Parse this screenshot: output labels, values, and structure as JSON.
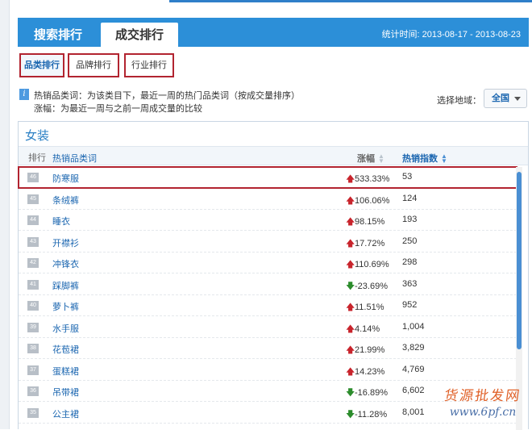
{
  "header": {
    "tabs": [
      {
        "label": "搜索排行"
      },
      {
        "label": "成交排行"
      }
    ],
    "period": "统计时间: 2013-08-17 - 2013-08-23"
  },
  "subtabs": [
    {
      "label": "品类排行"
    },
    {
      "label": "品牌排行"
    },
    {
      "label": "行业排行"
    }
  ],
  "info": {
    "line1": "热销品类词：为该类目下，最近一周的热门品类词（按成交量排序）",
    "line2": "涨幅：为最近一周与之前一周成交量的比较"
  },
  "region": {
    "label": "选择地域：",
    "selected": "全国"
  },
  "panel": {
    "title": "女装",
    "columns": {
      "rank": "排行",
      "word": "热销品类词",
      "growth": "涨幅",
      "hot": "热销指数"
    },
    "rows": [
      {
        "rank": "46",
        "word": "防寒服",
        "dir": "up",
        "growth": "533.33%",
        "hot": "53",
        "highlight": true
      },
      {
        "rank": "45",
        "word": "条绒裤",
        "dir": "up",
        "growth": "106.06%",
        "hot": "124"
      },
      {
        "rank": "44",
        "word": "睡衣",
        "dir": "up",
        "growth": "98.15%",
        "hot": "193"
      },
      {
        "rank": "43",
        "word": "开襟衫",
        "dir": "up",
        "growth": "17.72%",
        "hot": "250"
      },
      {
        "rank": "42",
        "word": "冲锋衣",
        "dir": "up",
        "growth": "110.69%",
        "hot": "298"
      },
      {
        "rank": "41",
        "word": "踩脚裤",
        "dir": "down",
        "growth": "-23.69%",
        "hot": "363"
      },
      {
        "rank": "40",
        "word": "萝卜裤",
        "dir": "up",
        "growth": "11.51%",
        "hot": "952"
      },
      {
        "rank": "39",
        "word": "水手服",
        "dir": "up",
        "growth": "4.14%",
        "hot": "1,004"
      },
      {
        "rank": "38",
        "word": "花苞裙",
        "dir": "up",
        "growth": "21.99%",
        "hot": "3,829"
      },
      {
        "rank": "37",
        "word": "蛋糕裙",
        "dir": "up",
        "growth": "14.23%",
        "hot": "4,769"
      },
      {
        "rank": "36",
        "word": "吊带裙",
        "dir": "down",
        "growth": "-16.89%",
        "hot": "6,602"
      },
      {
        "rank": "35",
        "word": "公主裙",
        "dir": "down",
        "growth": "-11.28%",
        "hot": "8,001"
      }
    ]
  },
  "watermark": {
    "line1": "货源批发网",
    "line2": "www.6pf.cn"
  },
  "colors": {
    "header": "#2c8fd8",
    "up": "#c8242c",
    "down": "#2c8c2c",
    "link": "#1b66b0",
    "highlight": "#b22430"
  }
}
